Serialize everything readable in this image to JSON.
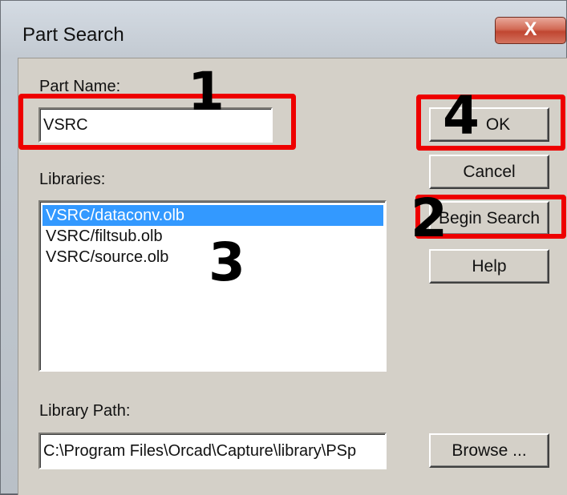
{
  "window": {
    "title": "Part Search",
    "close_label": "X"
  },
  "part_name": {
    "label": "Part Name:",
    "value": "VSRC"
  },
  "libraries": {
    "label": "Libraries:",
    "items": [
      "VSRC/dataconv.olb",
      "VSRC/filtsub.olb",
      "VSRC/source.olb"
    ],
    "selected_index": 0
  },
  "library_path": {
    "label": "Library Path:",
    "value": "C:\\Program Files\\Orcad\\Capture\\library\\PSp"
  },
  "buttons": {
    "ok": "OK",
    "cancel": "Cancel",
    "begin_search": "Begin Search",
    "help": "Help",
    "browse": "Browse ..."
  },
  "annotations": {
    "n1": "1",
    "n2": "2",
    "n3": "3",
    "n4": "4"
  },
  "colors": {
    "callout": "#ee0000",
    "selection": "#3399ff",
    "dialog_face": "#d4d0c8"
  }
}
